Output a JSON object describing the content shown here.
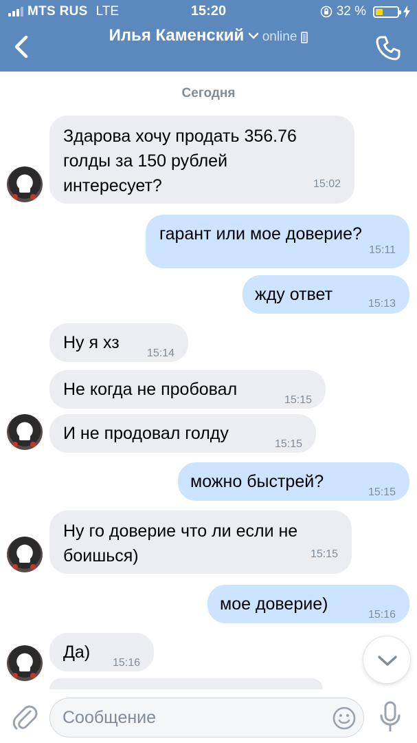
{
  "status_bar": {
    "carrier": "MTS RUS",
    "network": "LTE",
    "time": "15:20",
    "battery_percent": "32 %",
    "battery_level": 0.32
  },
  "header": {
    "contact_name": "Илья Каменский",
    "status": "online",
    "icons": [
      "back-icon",
      "chevron-down-icon",
      "mobile-icon",
      "phone-icon"
    ]
  },
  "date_separator": "Сегодня",
  "messages": [
    {
      "direction": "in",
      "lines": [
        "Здарова хочу продать 356.76",
        "голды за 150 рублей",
        "интересует?"
      ],
      "time": "15:02"
    },
    {
      "direction": "out",
      "lines": [
        "гарант или мое доверие?"
      ],
      "time": "15:11"
    },
    {
      "direction": "out",
      "lines": [
        "жду ответ"
      ],
      "time": "15:13"
    },
    {
      "direction": "in",
      "lines": [
        "Ну я хз"
      ],
      "time": "15:14"
    },
    {
      "direction": "in",
      "lines": [
        "Не когда не пробовал"
      ],
      "time": "15:15"
    },
    {
      "direction": "in",
      "lines": [
        "И не продовал голду"
      ],
      "time": "15:15"
    },
    {
      "direction": "out",
      "lines": [
        "можно быстрей?"
      ],
      "time": "15:15"
    },
    {
      "direction": "in",
      "lines": [
        "Ну го доверие что ли если не",
        "боишься)"
      ],
      "time": "15:15"
    },
    {
      "direction": "out",
      "lines": [
        "мое доверие)"
      ],
      "time": "15:16"
    },
    {
      "direction": "in",
      "lines": [
        "Да)"
      ],
      "time": "15:16"
    }
  ],
  "input": {
    "placeholder": "Сообщение",
    "value": ""
  },
  "colors": {
    "header_bg": "#5b88bd",
    "incoming_bubble": "#ebedf0",
    "outgoing_bubble": "#cce4ff",
    "meta_text": "#818c99"
  }
}
